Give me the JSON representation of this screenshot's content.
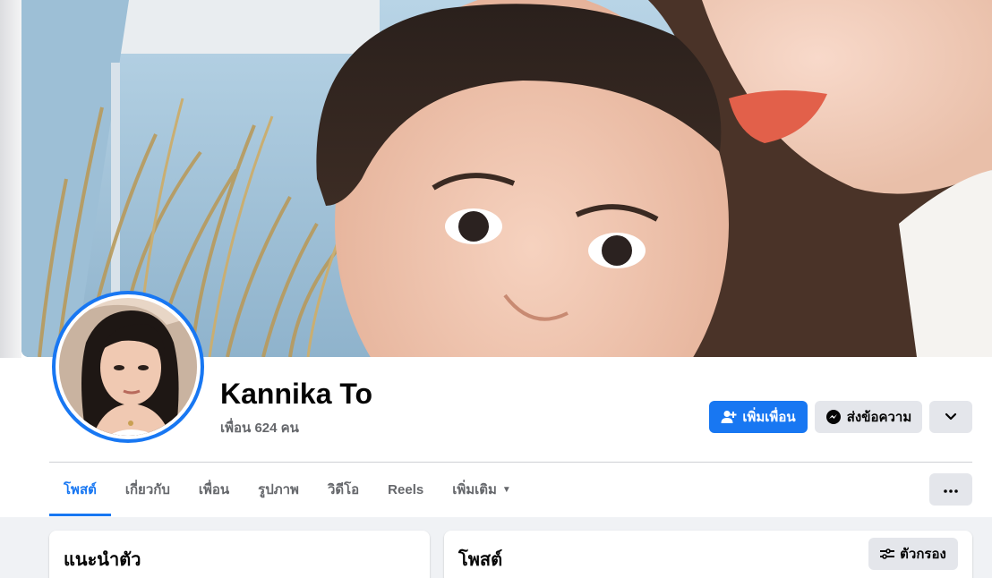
{
  "profile": {
    "name": "Kannika To",
    "friends": "เพื่อน 624 คน"
  },
  "actions": {
    "add_friend": "เพิ่มเพื่อน",
    "message": "ส่งข้อความ"
  },
  "tabs": [
    {
      "label": "โพสต์"
    },
    {
      "label": "เกี่ยวกับ"
    },
    {
      "label": "เพื่อน"
    },
    {
      "label": "รูปภาพ"
    },
    {
      "label": "วิดีโอ"
    },
    {
      "label": "Reels"
    },
    {
      "label": "เพิ่มเติม"
    }
  ],
  "intro": {
    "title": "แนะนำตัว"
  },
  "posts": {
    "title": "โพสต์",
    "filter_label": "ตัวกรอง"
  },
  "colors": {
    "accent": "#1877f2",
    "button_gray": "#e4e6eb",
    "page_bg": "#f0f2f5"
  }
}
